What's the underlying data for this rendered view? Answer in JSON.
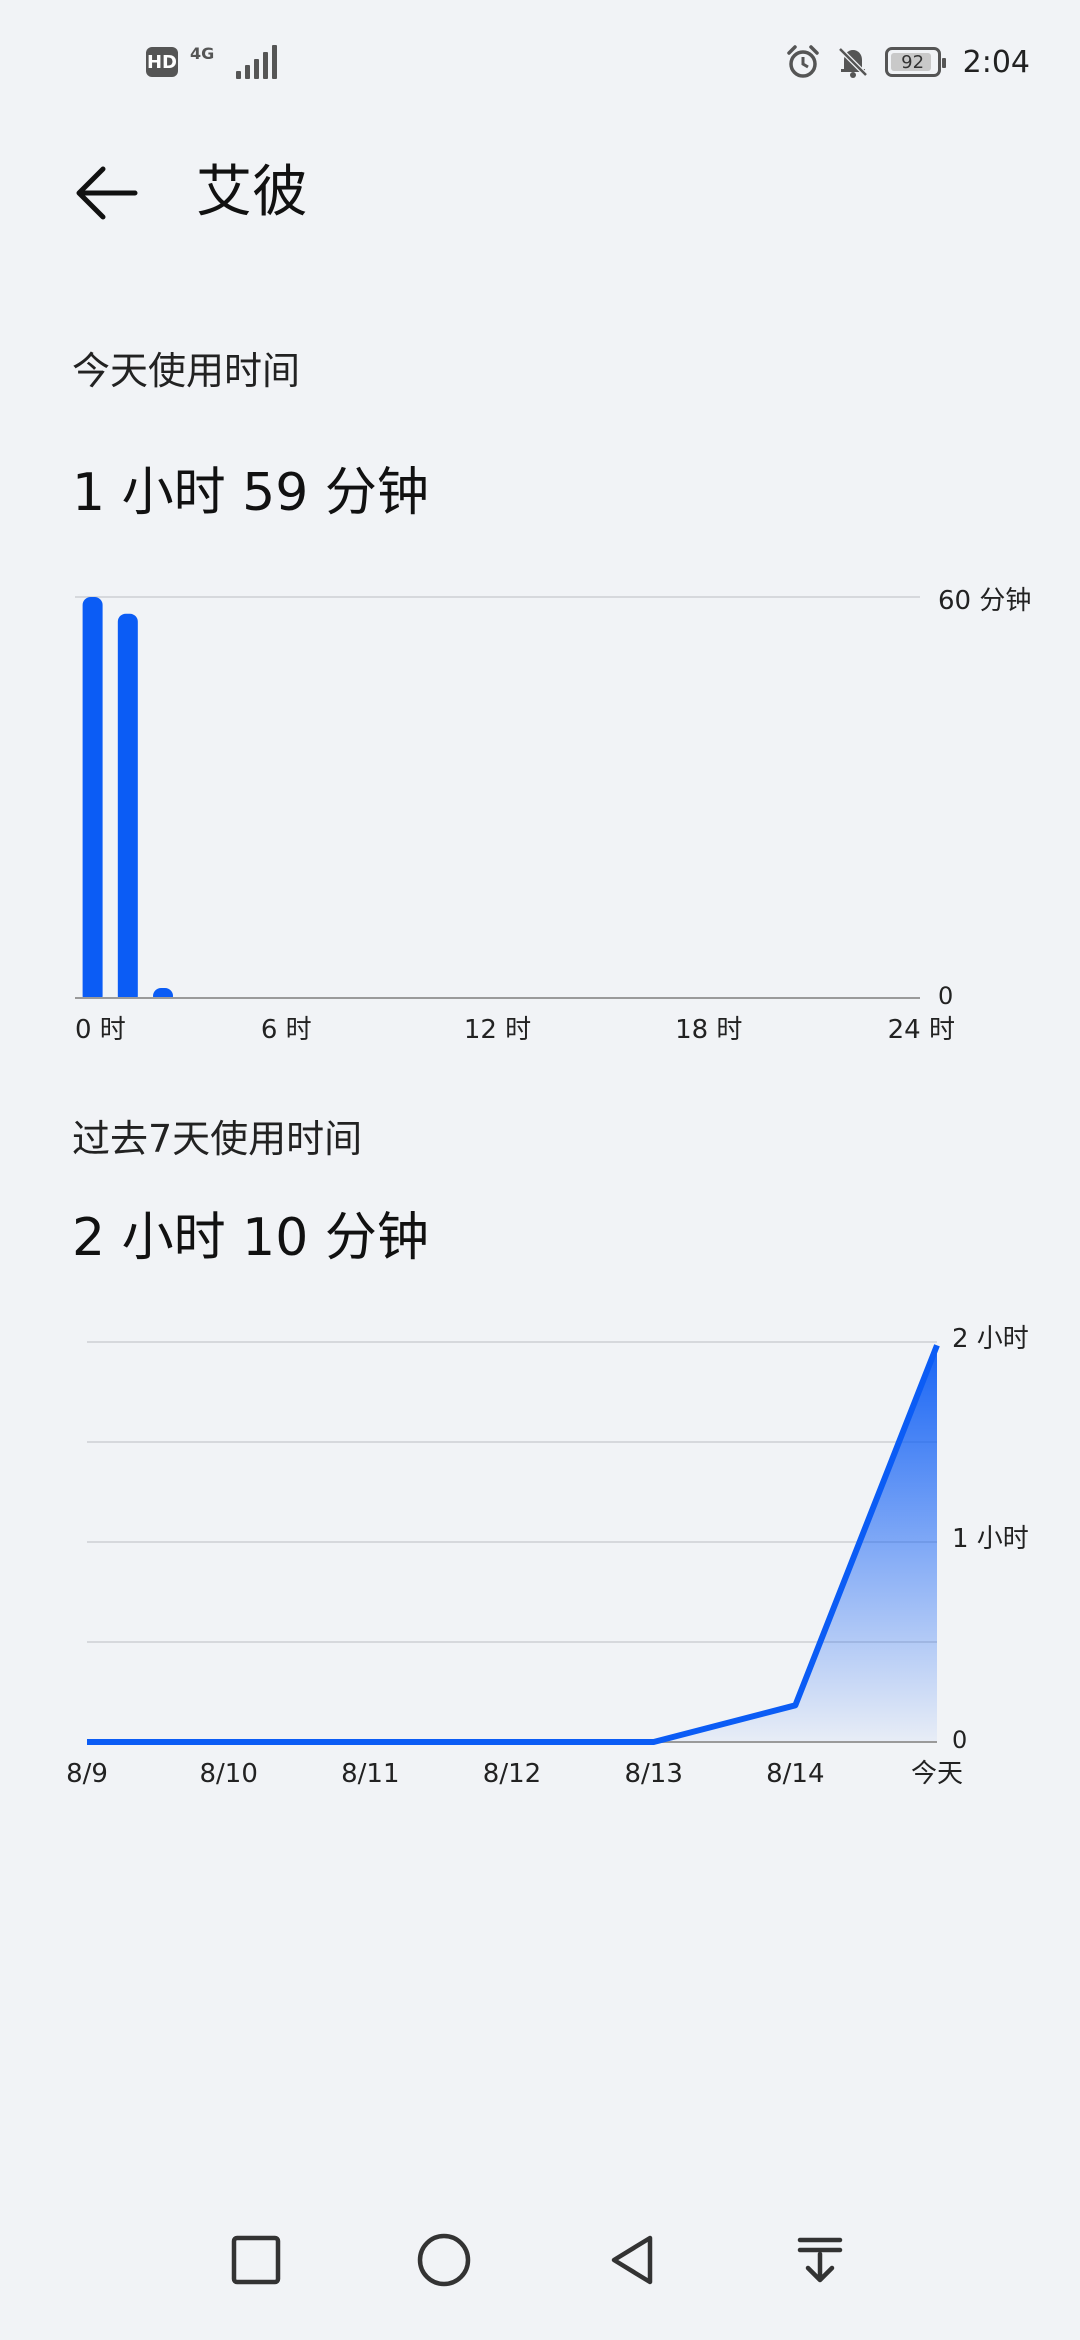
{
  "status_bar": {
    "hd": "HD",
    "network": "4G",
    "battery": "92",
    "battery_level": 0.92,
    "time": "2:04",
    "icons": [
      "alarm-icon",
      "mute-bell-icon",
      "battery-icon",
      "signal-icon"
    ]
  },
  "header": {
    "title": "艾彼"
  },
  "today": {
    "label": "今天使用时间",
    "total": "1 小时 59 分钟"
  },
  "week": {
    "label": "过去7天使用时间",
    "total": "2 小时 10 分钟"
  },
  "colors": {
    "accent": "#0b5cf5",
    "grid": "#d6d8dc",
    "axis": "#9a9a9a",
    "background": "#f1f3f6"
  },
  "chart_data": [
    {
      "type": "bar",
      "name": "today_hourly",
      "x_ticks": [
        "0 时",
        "6 时",
        "12 时",
        "18 时",
        "24 时"
      ],
      "y_ticks": [
        "60 分钟",
        "0"
      ],
      "ylim": [
        0,
        60
      ],
      "xlim": [
        0,
        24
      ],
      "hours": [
        0,
        1,
        2
      ],
      "values": [
        60,
        57.5,
        1.5
      ]
    },
    {
      "type": "area",
      "name": "last_7_days",
      "categories": [
        "8/9",
        "8/10",
        "8/11",
        "8/12",
        "8/13",
        "8/14",
        "今天"
      ],
      "y_ticks": [
        "2 小时",
        "1 小时",
        "0"
      ],
      "ylim": [
        0,
        120
      ],
      "values": [
        0,
        0,
        0,
        0,
        0,
        11,
        119
      ]
    }
  ]
}
